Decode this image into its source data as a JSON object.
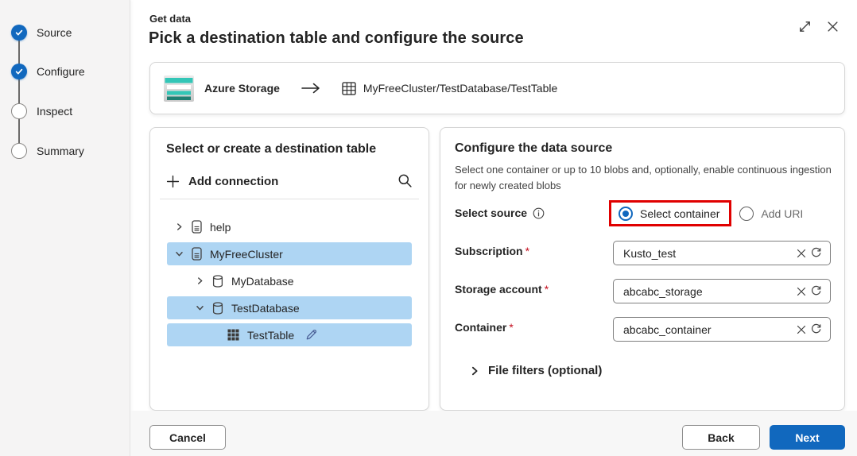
{
  "dialog": {
    "eyebrow": "Get data",
    "title": "Pick a destination table and configure the source"
  },
  "stepper": {
    "items": [
      {
        "label": "Source",
        "state": "complete"
      },
      {
        "label": "Configure",
        "state": "complete"
      },
      {
        "label": "Inspect",
        "state": "upcoming"
      },
      {
        "label": "Summary",
        "state": "upcoming"
      }
    ]
  },
  "source_bar": {
    "source_name": "Azure Storage",
    "destination_path": "MyFreeCluster/TestDatabase/TestTable"
  },
  "destination_panel": {
    "title": "Select or create a destination table",
    "add_connection_label": "Add connection",
    "tree": [
      {
        "label": "help",
        "type": "cluster",
        "expanded": false,
        "selected": false
      },
      {
        "label": "MyFreeCluster",
        "type": "cluster",
        "expanded": true,
        "selected": true
      },
      {
        "label": "MyDatabase",
        "type": "database",
        "expanded": false,
        "selected": false
      },
      {
        "label": "TestDatabase",
        "type": "database",
        "expanded": true,
        "selected": true
      },
      {
        "label": "TestTable",
        "type": "table",
        "selected": true,
        "editable": true
      }
    ]
  },
  "configure_panel": {
    "title": "Configure the data source",
    "description": "Select one container or up to 10 blobs and, optionally, enable continuous ingestion for newly created blobs",
    "select_source_label": "Select source",
    "required_marker": "*",
    "radios": [
      {
        "label": "Select container",
        "selected": true,
        "annotated": true
      },
      {
        "label": "Add URI",
        "selected": false,
        "annotated": false
      }
    ],
    "fields": [
      {
        "label": "Subscription",
        "required": true,
        "value": "Kusto_test"
      },
      {
        "label": "Storage account",
        "required": true,
        "value": "abcabc_storage"
      },
      {
        "label": "Container",
        "required": true,
        "value": "abcabc_container"
      }
    ],
    "file_filters_label": "File filters (optional)"
  },
  "footer": {
    "cancel_label": "Cancel",
    "back_label": "Back",
    "next_label": "Next"
  },
  "icons": {
    "step-complete": "check",
    "expand": "diagonal-resize-arrow",
    "close": "x",
    "add": "plus",
    "search": "magnifier",
    "chevron-right": "›",
    "chevron-down": "⌄",
    "cluster": "server-rect",
    "database": "cylinder",
    "table": "filled-grid",
    "edit": "pencil",
    "info": "ⓘ",
    "clear": "✕",
    "refresh": "↻",
    "arrow-right": "→",
    "destination-table": "outline-grid"
  },
  "colors": {
    "accent_blue": "#1168be",
    "selection_blue": "#aed5f3",
    "annotation_red": "#e00000",
    "required_red": "#c50f1f",
    "storage_teal": "#33c6b7",
    "storage_teal_dark": "#1f7e72",
    "sidebar_bg": "#f5f4f4",
    "footer_bg": "#f7f7f7"
  }
}
